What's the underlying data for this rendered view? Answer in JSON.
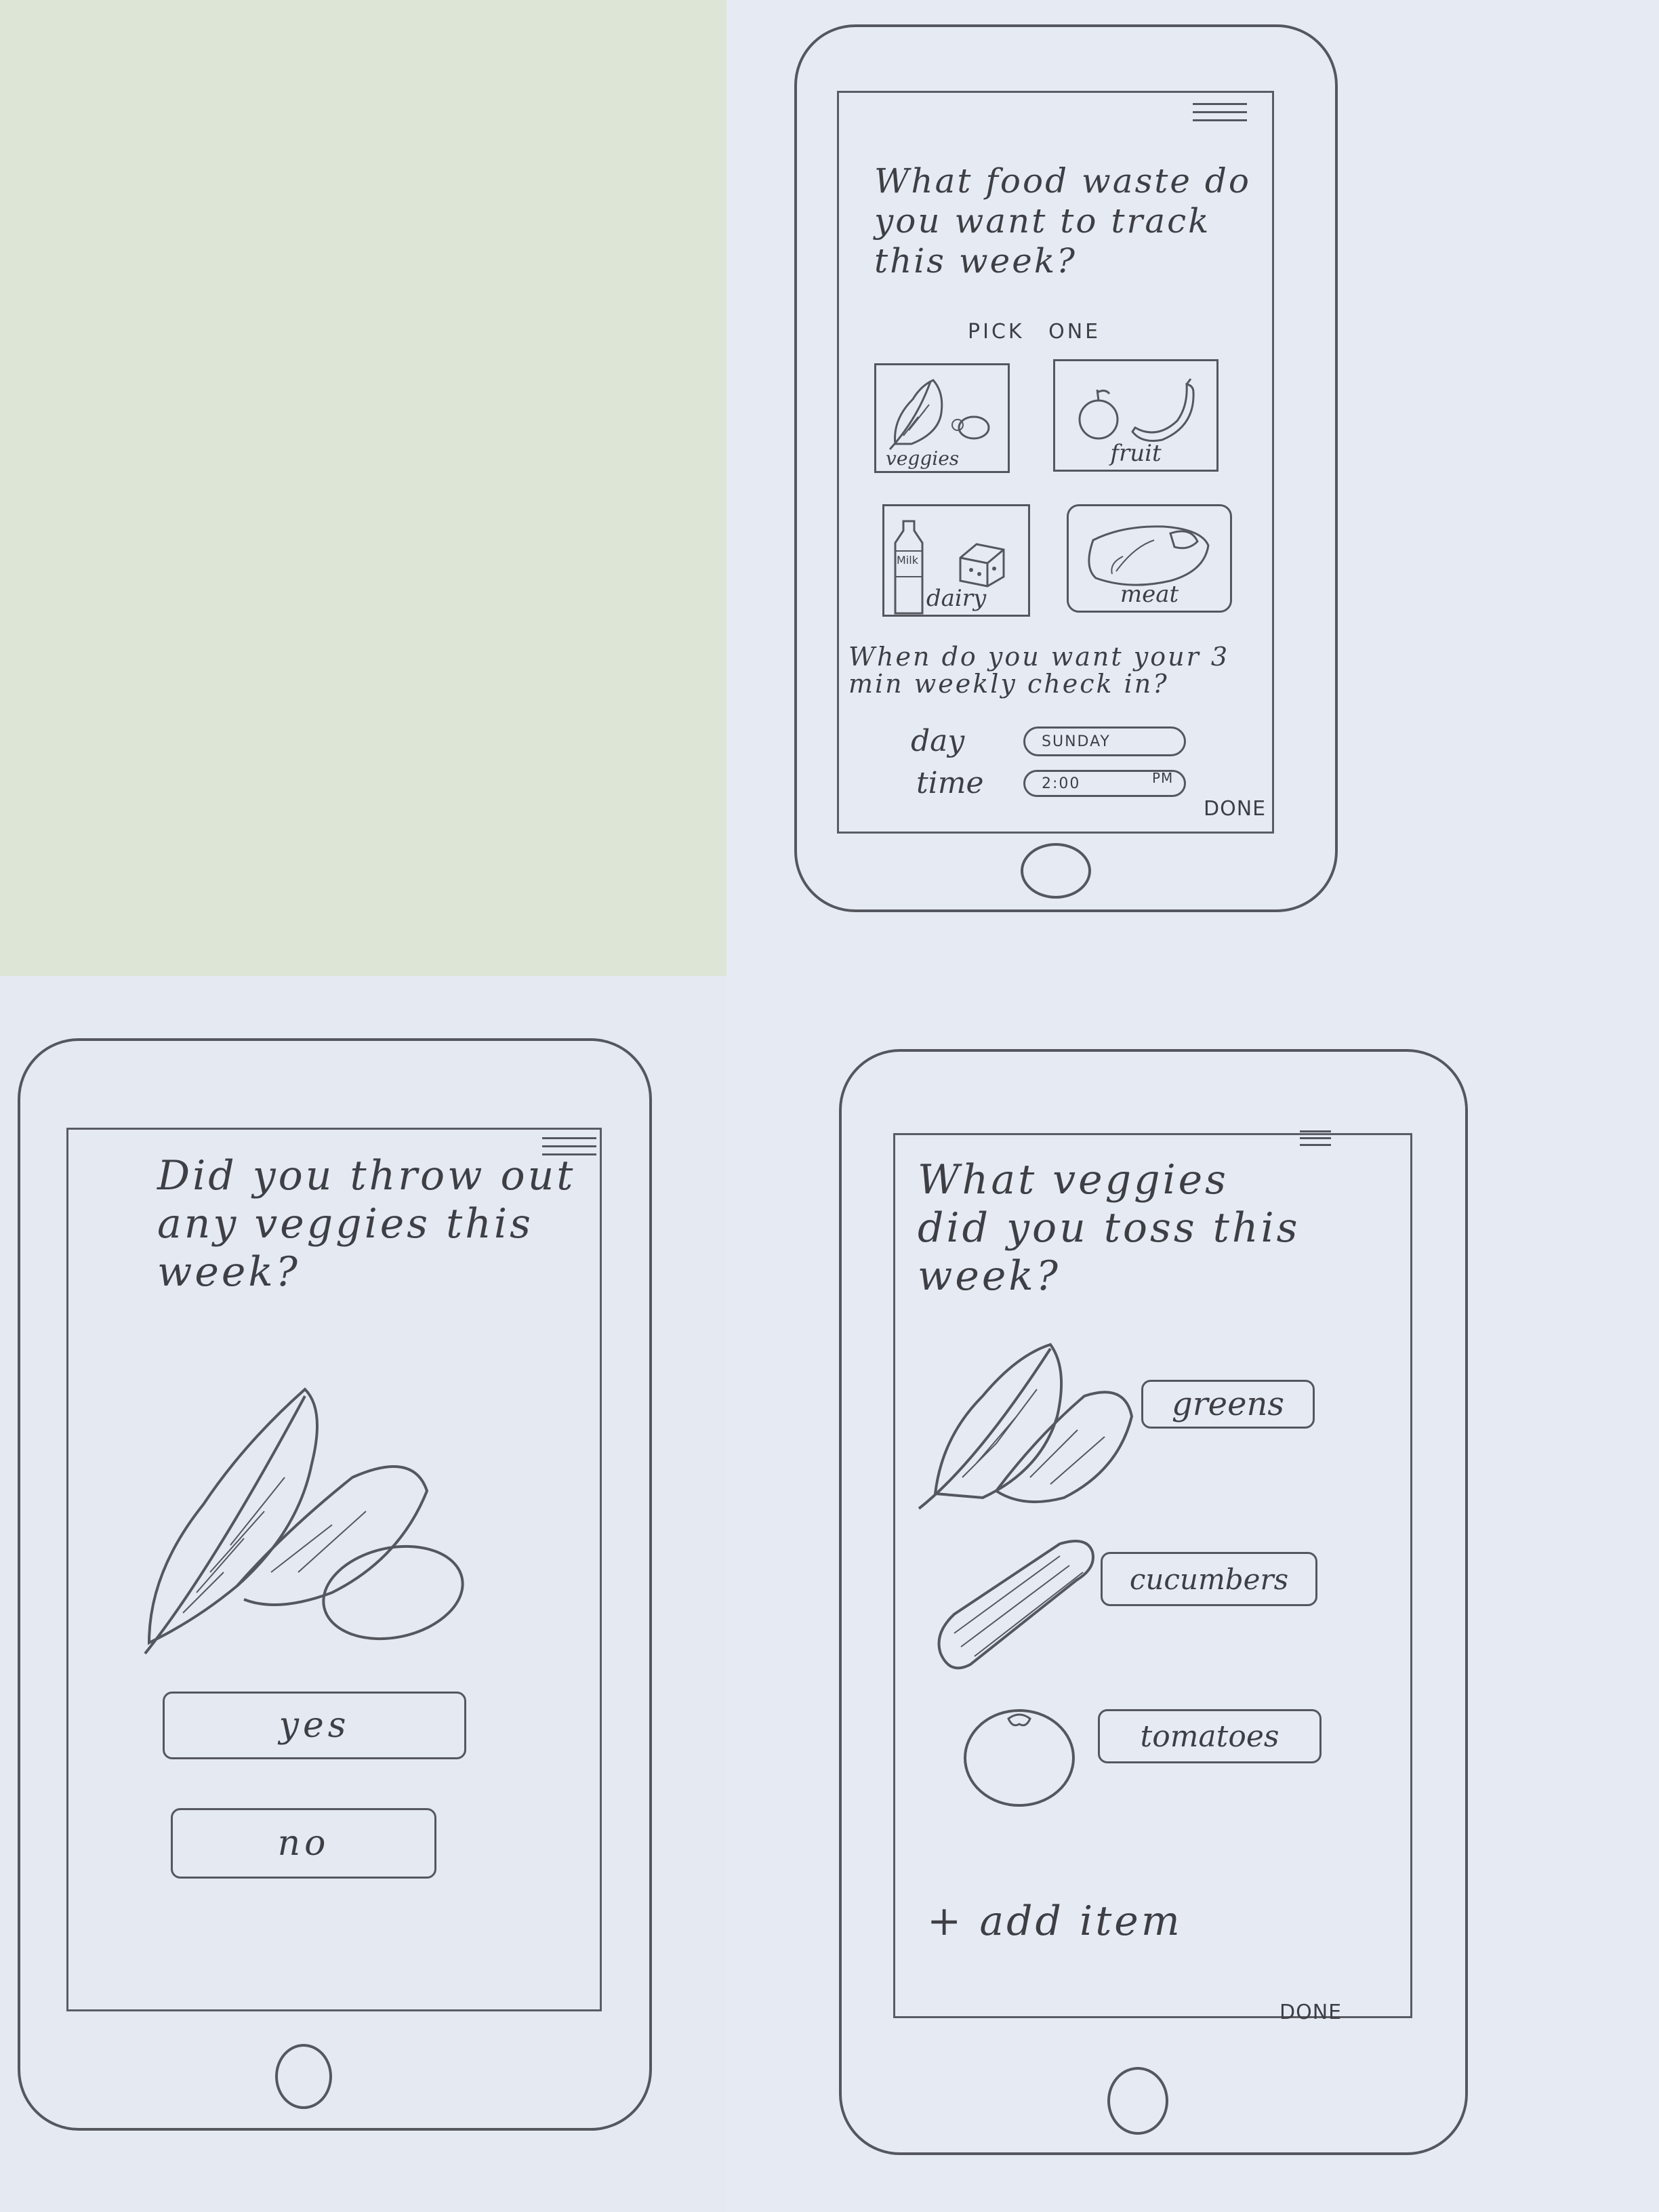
{
  "screen_setup": {
    "question": "What food waste do you want to track this week?",
    "hint": "PICK ONE",
    "categories": [
      {
        "label": "veggies",
        "icon": "veggies-icon"
      },
      {
        "label": "fruit",
        "icon": "fruit-icon"
      },
      {
        "label": "dairy",
        "icon": "dairy-icon",
        "milk_text": "Milk"
      },
      {
        "label": "meat",
        "icon": "meat-icon"
      }
    ],
    "checkin_prompt": "When do you want your 3 min weekly check in?",
    "day_label": "day",
    "day_value": "SUNDAY",
    "time_label": "time",
    "time_value": "2:00",
    "time_period": "PM",
    "done_label": "DONE"
  },
  "screen_veggies_check": {
    "question": "Did you throw out any veggies this week?",
    "yes_label": "yes",
    "no_label": "no"
  },
  "screen_veggies_list": {
    "question": "What veggies did you toss this week?",
    "items": [
      {
        "label": "greens",
        "icon": "greens-icon"
      },
      {
        "label": "cucumbers",
        "icon": "cucumber-icon"
      },
      {
        "label": "tomatoes",
        "icon": "tomato-icon"
      }
    ],
    "add_item_label": "+ add item",
    "done_label": "DONE"
  },
  "colors": {
    "pencil": "#55575e",
    "paper": "#e6ebf3",
    "sticky_sheet": "#dde5d6"
  }
}
